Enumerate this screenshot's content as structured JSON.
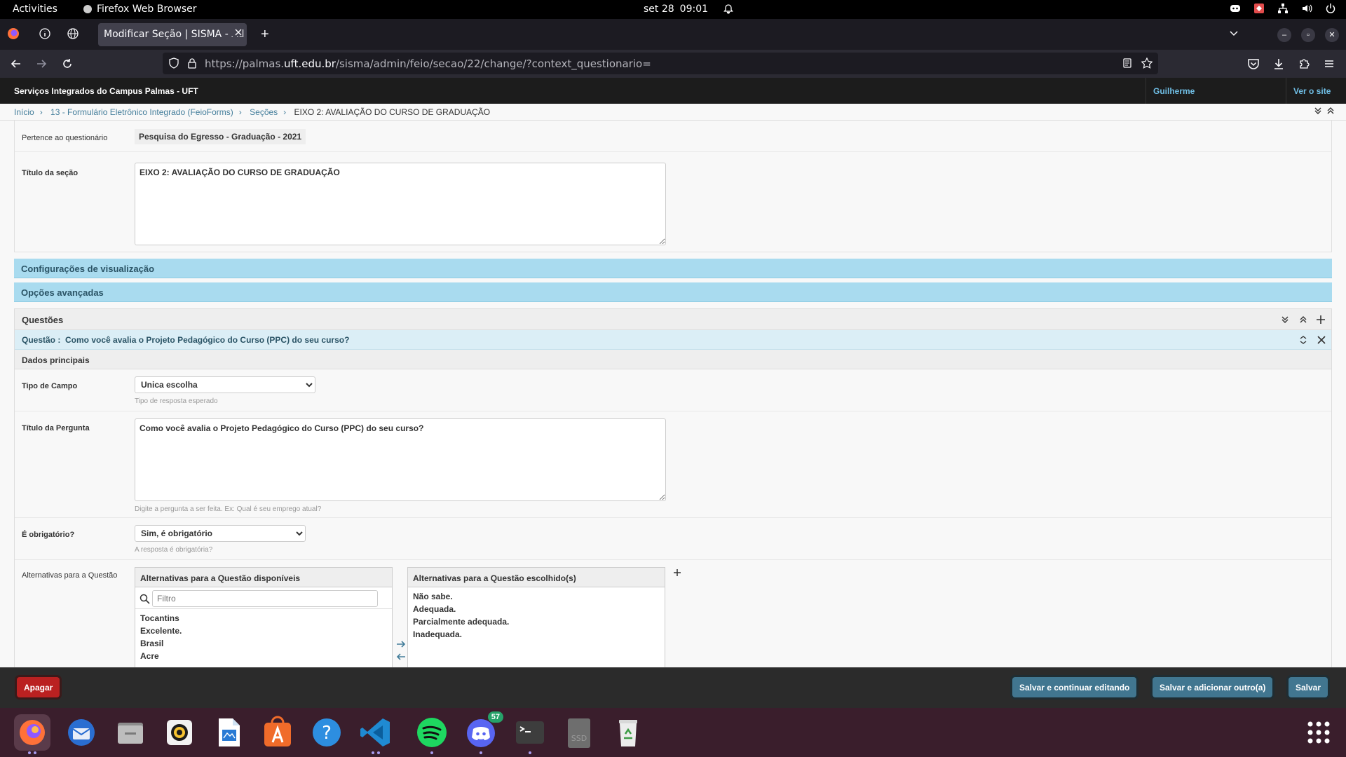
{
  "system": {
    "activities": "Activities",
    "app_name": "Firefox Web Browser",
    "date": "set 28",
    "time": "09:01"
  },
  "browser": {
    "tab_title": "Modificar Seção | SISMA - Ad",
    "url_prefix": "https://palmas.",
    "url_domain": "uft.edu.br",
    "url_path": "/sisma/admin/feio/secao/22/change/?context_questionario="
  },
  "header": {
    "brand": "Serviços Integrados do Campus Palmas - UFT",
    "user": "Guilherme",
    "view_site": "Ver o site"
  },
  "breadcrumbs": {
    "home": "Início",
    "app": "13 - Formulário Eletrônico Integrado (FeioForms)",
    "model": "Seções",
    "current": "EIXO 2: AVALIAÇÃO DO CURSO DE GRADUAÇÃO"
  },
  "form": {
    "questionario_label": "Pertence ao questionário",
    "questionario_value": "Pesquisa do Egresso - Graduação - 2021",
    "titulo_secao_label": "Título da seção",
    "titulo_secao_value": "EIXO 2: AVALIAÇÃO DO CURSO DE GRADUAÇÃO",
    "config_visualizacao": "Configurações de visualização",
    "opcoes_avancadas": "Opções avançadas"
  },
  "questoes": {
    "header": "Questões",
    "questao_label": "Questão :",
    "questao_title": "Como você avalia o Projeto Pedagógico do Curso (PPC) do seu curso?",
    "dados_principais": "Dados principais",
    "tipo_campo_label": "Tipo de Campo",
    "tipo_campo_value": "Unica escolha",
    "tipo_campo_help": "Tipo de resposta esperado",
    "titulo_pergunta_label": "Título da Pergunta",
    "titulo_pergunta_value": "Como você avalia o Projeto Pedagógico do Curso (PPC) do seu curso?",
    "titulo_pergunta_help": "Digite a pergunta a ser feita. Ex: Qual é seu emprego atual?",
    "obrigatorio_label": "É obrigatório?",
    "obrigatorio_value": "Sim, é obrigatório",
    "obrigatorio_help": "A resposta é obrigatória?",
    "alternativas_label": "Alternativas para a Questão",
    "disponiveis_header": "Alternativas para a Questão disponíveis",
    "filtro_placeholder": "Filtro",
    "disponiveis": [
      "Tocantins",
      "Excelente.",
      "Brasil",
      "Acre"
    ],
    "escolhidos_header": "Alternativas para a Questão escolhido(s)",
    "escolhidos": [
      "Não sabe.",
      "Adequada.",
      "Parcialmente adequada.",
      "Inadequada."
    ]
  },
  "actions": {
    "delete": "Apagar",
    "save_continue": "Salvar e continuar editando",
    "save_add": "Salvar e adicionar outro(a)",
    "save": "Salvar"
  },
  "dock": {
    "discord_badge": "57",
    "ssd_label": "SSD"
  },
  "colors": {
    "django_blue": "#417690",
    "link_blue": "#447e9b",
    "collapse_bg": "#a9dbef",
    "delete_red": "#ba2121"
  }
}
